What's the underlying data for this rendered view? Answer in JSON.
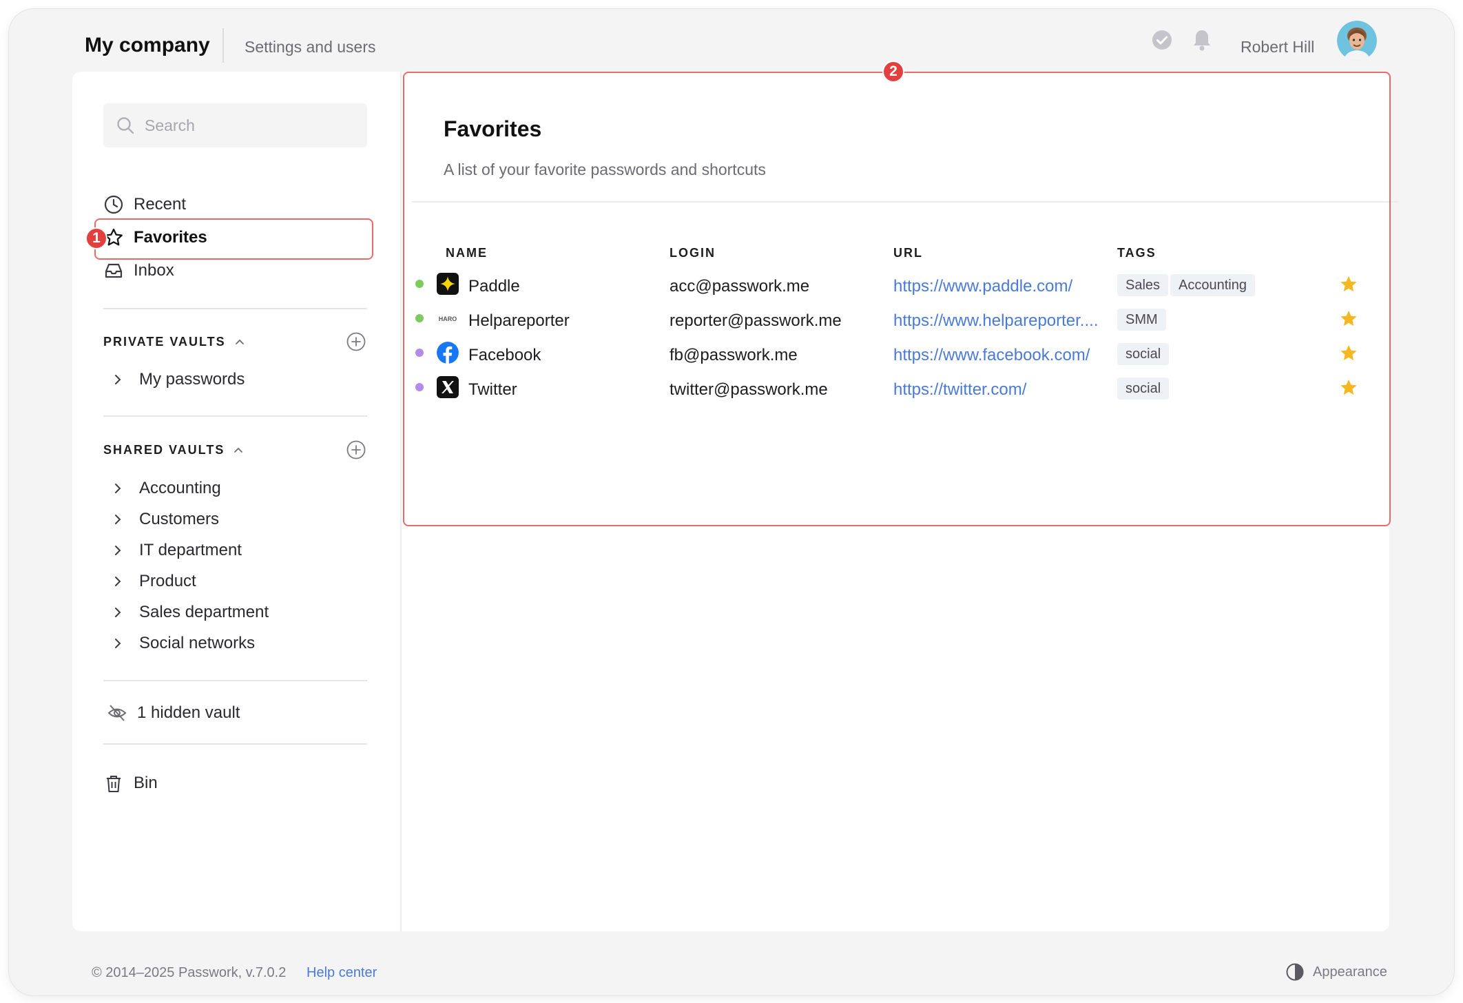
{
  "header": {
    "company": "My company",
    "settings_link": "Settings and users",
    "user_name": "Robert Hill"
  },
  "sidebar": {
    "search_placeholder": "Search",
    "nav": [
      {
        "label": "Recent",
        "icon": "clock-icon"
      },
      {
        "label": "Favorites",
        "icon": "star-icon"
      },
      {
        "label": "Inbox",
        "icon": "inbox-icon"
      }
    ],
    "private_vaults": {
      "heading": "PRIVATE VAULTS",
      "items": [
        "My passwords"
      ]
    },
    "shared_vaults": {
      "heading": "SHARED VAULTS",
      "items": [
        "Accounting",
        "Customers",
        "IT department",
        "Product",
        "Sales department",
        "Social networks"
      ]
    },
    "hidden_vault": "1 hidden vault",
    "bin": "Bin"
  },
  "annotations": {
    "badge_1": "1",
    "badge_2": "2"
  },
  "favorites": {
    "title": "Favorites",
    "subtitle": "A list of your favorite passwords and shortcuts",
    "columns": [
      "NAME",
      "LOGIN",
      "URL",
      "TAGS"
    ],
    "rows": [
      {
        "name": "Paddle",
        "login": "acc@passwork.me",
        "url": "https://www.paddle.com/",
        "tags": [
          "Sales",
          "Accounting"
        ],
        "dot_color": "#7ccb5c",
        "logo": "paddle-logo-icon"
      },
      {
        "name": "Helpareporter",
        "login": "reporter@passwork.me",
        "url": "https://www.helpareporter....",
        "tags": [
          "SMM"
        ],
        "dot_color": "#7ccb5c",
        "logo": "haro-logo-icon"
      },
      {
        "name": "Facebook",
        "login": "fb@passwork.me",
        "url": "https://www.facebook.com/",
        "tags": [
          "social"
        ],
        "dot_color": "#b48be8",
        "logo": "facebook-logo-icon"
      },
      {
        "name": "Twitter",
        "login": "twitter@passwork.me",
        "url": "https://twitter.com/",
        "tags": [
          "social"
        ],
        "dot_color": "#b48be8",
        "logo": "x-logo-icon"
      }
    ]
  },
  "footer": {
    "copyright": "© 2014–2025 Passwork, v.7.0.2",
    "help": "Help center",
    "appearance": "Appearance"
  },
  "colors": {
    "accent_link": "#4a7ad9",
    "annotation_red": "#e2403f",
    "star": "#f5b820"
  }
}
